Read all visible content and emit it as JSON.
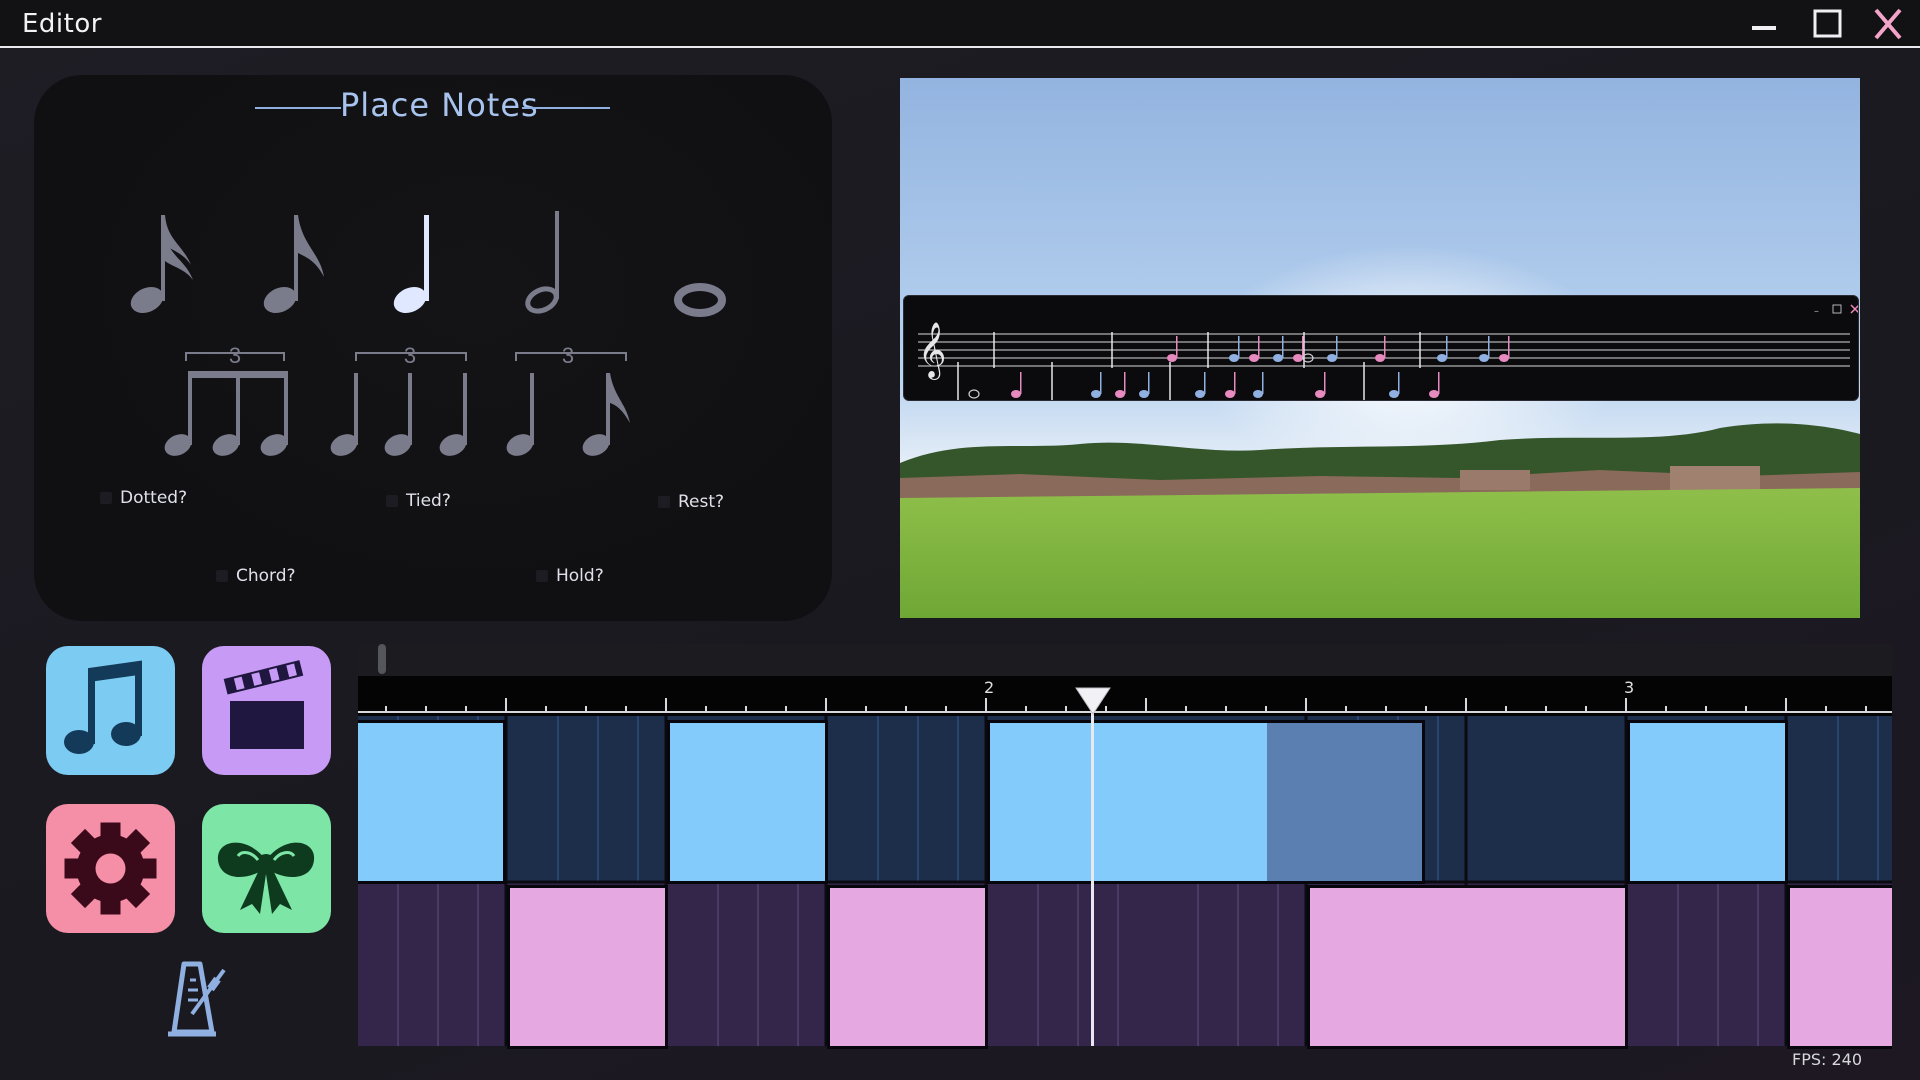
{
  "window": {
    "title": "Editor",
    "controls": [
      "minimize",
      "maximize",
      "close"
    ]
  },
  "place_notes": {
    "title": "Place Notes",
    "notes": [
      "sixteenth-note",
      "eighth-note",
      "quarter-note",
      "half-note",
      "whole-note",
      "eighth-triplet",
      "quarter-triplet",
      "quarter-eighth-triplet"
    ],
    "selected": "quarter-note",
    "triplet_label": "3",
    "options": {
      "dotted": "Dotted?",
      "tied": "Tied?",
      "rest": "Rest?",
      "chord": "Chord?",
      "hold": "Hold?"
    }
  },
  "sidebar": {
    "buttons": [
      {
        "name": "music-notes-icon",
        "color": "#7ccbf3"
      },
      {
        "name": "clapperboard-icon",
        "color": "#c79af5"
      },
      {
        "name": "gear-icon",
        "color": "#f58fa8"
      },
      {
        "name": "bow-icon",
        "color": "#7de5a6"
      }
    ],
    "metronome": "metronome-icon"
  },
  "timeline": {
    "measure_labels": [
      "2",
      "3"
    ],
    "colors": {
      "blue_note": "#83cbfb",
      "blue_selected": "#5a7fb0",
      "pink_note": "#e6a8e1",
      "blue_lane": "#1c2e4a",
      "purple_lane": "#33264a"
    }
  },
  "status": {
    "fps": "FPS: 240"
  }
}
